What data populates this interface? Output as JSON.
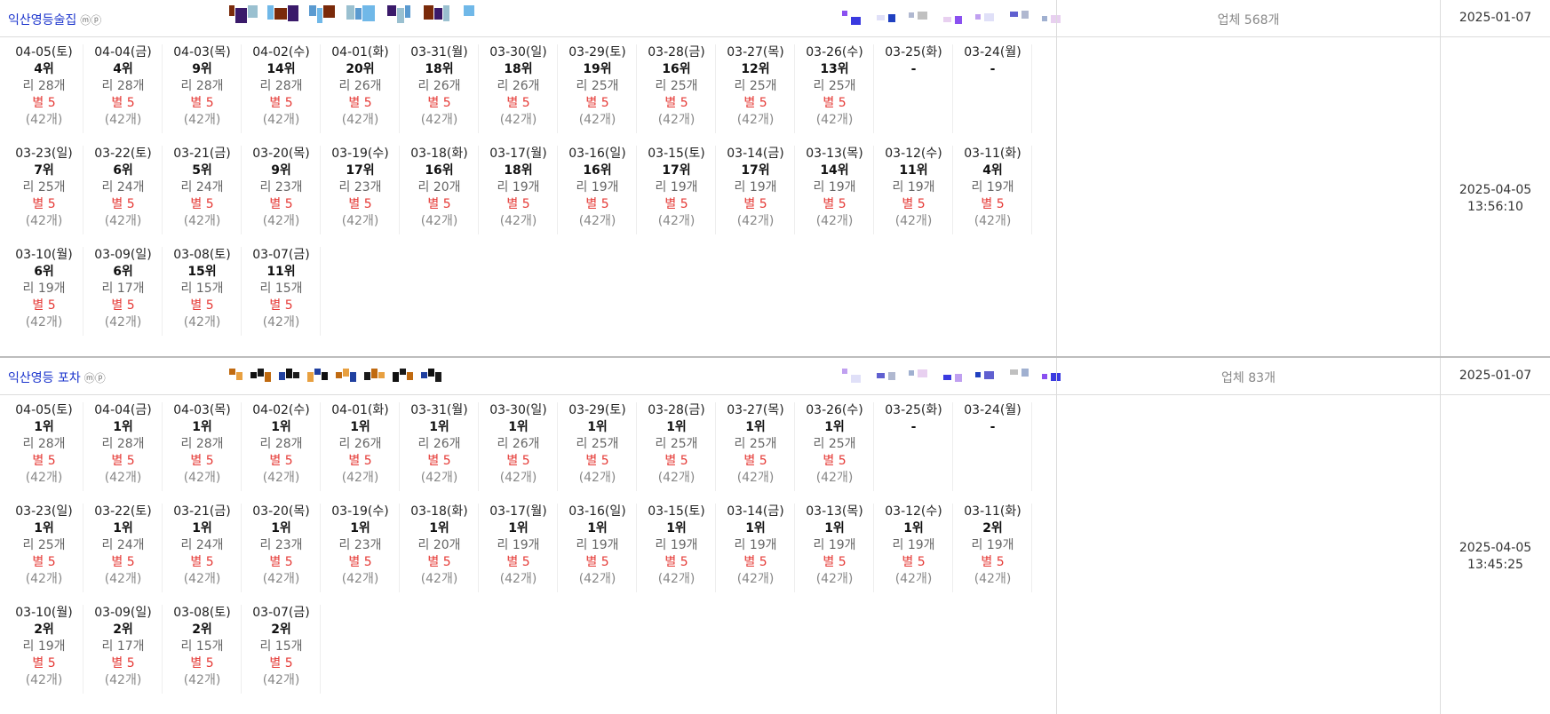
{
  "stores": [
    {
      "name": "익산영등술집",
      "badges": "ⓜⓟ",
      "count": "업체 568개",
      "start_date": "2025-01-07",
      "updated_date": "2025-04-05",
      "updated_time": "13:56:10",
      "rows": [
        [
          {
            "d": "04-05(토)",
            "r": "4위",
            "v": "리 28개",
            "s": "별 5",
            "c": "(42개)"
          },
          {
            "d": "04-04(금)",
            "r": "4위",
            "v": "리 28개",
            "s": "별 5",
            "c": "(42개)"
          },
          {
            "d": "04-03(목)",
            "r": "9위",
            "v": "리 28개",
            "s": "별 5",
            "c": "(42개)"
          },
          {
            "d": "04-02(수)",
            "r": "14위",
            "v": "리 28개",
            "s": "별 5",
            "c": "(42개)"
          },
          {
            "d": "04-01(화)",
            "r": "20위",
            "v": "리 26개",
            "s": "별 5",
            "c": "(42개)"
          },
          {
            "d": "03-31(월)",
            "r": "18위",
            "v": "리 26개",
            "s": "별 5",
            "c": "(42개)"
          },
          {
            "d": "03-30(일)",
            "r": "18위",
            "v": "리 26개",
            "s": "별 5",
            "c": "(42개)"
          },
          {
            "d": "03-29(토)",
            "r": "19위",
            "v": "리 25개",
            "s": "별 5",
            "c": "(42개)"
          },
          {
            "d": "03-28(금)",
            "r": "16위",
            "v": "리 25개",
            "s": "별 5",
            "c": "(42개)"
          },
          {
            "d": "03-27(목)",
            "r": "12위",
            "v": "리 25개",
            "s": "별 5",
            "c": "(42개)"
          },
          {
            "d": "03-26(수)",
            "r": "13위",
            "v": "리 25개",
            "s": "별 5",
            "c": "(42개)"
          },
          {
            "d": "03-25(화)",
            "r": "-",
            "v": "",
            "s": "",
            "c": ""
          },
          {
            "d": "03-24(월)",
            "r": "-",
            "v": "",
            "s": "",
            "c": ""
          }
        ],
        [
          {
            "d": "03-23(일)",
            "r": "7위",
            "v": "리 25개",
            "s": "별 5",
            "c": "(42개)"
          },
          {
            "d": "03-22(토)",
            "r": "6위",
            "v": "리 24개",
            "s": "별 5",
            "c": "(42개)"
          },
          {
            "d": "03-21(금)",
            "r": "5위",
            "v": "리 24개",
            "s": "별 5",
            "c": "(42개)"
          },
          {
            "d": "03-20(목)",
            "r": "9위",
            "v": "리 23개",
            "s": "별 5",
            "c": "(42개)"
          },
          {
            "d": "03-19(수)",
            "r": "17위",
            "v": "리 23개",
            "s": "별 5",
            "c": "(42개)"
          },
          {
            "d": "03-18(화)",
            "r": "16위",
            "v": "리 20개",
            "s": "별 5",
            "c": "(42개)"
          },
          {
            "d": "03-17(월)",
            "r": "18위",
            "v": "리 19개",
            "s": "별 5",
            "c": "(42개)"
          },
          {
            "d": "03-16(일)",
            "r": "16위",
            "v": "리 19개",
            "s": "별 5",
            "c": "(42개)"
          },
          {
            "d": "03-15(토)",
            "r": "17위",
            "v": "리 19개",
            "s": "별 5",
            "c": "(42개)"
          },
          {
            "d": "03-14(금)",
            "r": "17위",
            "v": "리 19개",
            "s": "별 5",
            "c": "(42개)"
          },
          {
            "d": "03-13(목)",
            "r": "14위",
            "v": "리 19개",
            "s": "별 5",
            "c": "(42개)"
          },
          {
            "d": "03-12(수)",
            "r": "11위",
            "v": "리 19개",
            "s": "별 5",
            "c": "(42개)"
          },
          {
            "d": "03-11(화)",
            "r": "4위",
            "v": "리 19개",
            "s": "별 5",
            "c": "(42개)"
          }
        ],
        [
          {
            "d": "03-10(월)",
            "r": "6위",
            "v": "리 19개",
            "s": "별 5",
            "c": "(42개)"
          },
          {
            "d": "03-09(일)",
            "r": "6위",
            "v": "리 17개",
            "s": "별 5",
            "c": "(42개)"
          },
          {
            "d": "03-08(토)",
            "r": "15위",
            "v": "리 15개",
            "s": "별 5",
            "c": "(42개)"
          },
          {
            "d": "03-07(금)",
            "r": "11위",
            "v": "리 15개",
            "s": "별 5",
            "c": "(42개)"
          }
        ]
      ]
    },
    {
      "name": "익산영등 포차",
      "badges": "ⓜⓟ",
      "count": "업체 83개",
      "start_date": "2025-01-07",
      "updated_date": "2025-04-05",
      "updated_time": "13:45:25",
      "rows": [
        [
          {
            "d": "04-05(토)",
            "r": "1위",
            "v": "리 28개",
            "s": "별 5",
            "c": "(42개)"
          },
          {
            "d": "04-04(금)",
            "r": "1위",
            "v": "리 28개",
            "s": "별 5",
            "c": "(42개)"
          },
          {
            "d": "04-03(목)",
            "r": "1위",
            "v": "리 28개",
            "s": "별 5",
            "c": "(42개)"
          },
          {
            "d": "04-02(수)",
            "r": "1위",
            "v": "리 28개",
            "s": "별 5",
            "c": "(42개)"
          },
          {
            "d": "04-01(화)",
            "r": "1위",
            "v": "리 26개",
            "s": "별 5",
            "c": "(42개)"
          },
          {
            "d": "03-31(월)",
            "r": "1위",
            "v": "리 26개",
            "s": "별 5",
            "c": "(42개)"
          },
          {
            "d": "03-30(일)",
            "r": "1위",
            "v": "리 26개",
            "s": "별 5",
            "c": "(42개)"
          },
          {
            "d": "03-29(토)",
            "r": "1위",
            "v": "리 25개",
            "s": "별 5",
            "c": "(42개)"
          },
          {
            "d": "03-28(금)",
            "r": "1위",
            "v": "리 25개",
            "s": "별 5",
            "c": "(42개)"
          },
          {
            "d": "03-27(목)",
            "r": "1위",
            "v": "리 25개",
            "s": "별 5",
            "c": "(42개)"
          },
          {
            "d": "03-26(수)",
            "r": "1위",
            "v": "리 25개",
            "s": "별 5",
            "c": "(42개)"
          },
          {
            "d": "03-25(화)",
            "r": "-",
            "v": "",
            "s": "",
            "c": ""
          },
          {
            "d": "03-24(월)",
            "r": "-",
            "v": "",
            "s": "",
            "c": ""
          }
        ],
        [
          {
            "d": "03-23(일)",
            "r": "1위",
            "v": "리 25개",
            "s": "별 5",
            "c": "(42개)"
          },
          {
            "d": "03-22(토)",
            "r": "1위",
            "v": "리 24개",
            "s": "별 5",
            "c": "(42개)"
          },
          {
            "d": "03-21(금)",
            "r": "1위",
            "v": "리 24개",
            "s": "별 5",
            "c": "(42개)"
          },
          {
            "d": "03-20(목)",
            "r": "1위",
            "v": "리 23개",
            "s": "별 5",
            "c": "(42개)"
          },
          {
            "d": "03-19(수)",
            "r": "1위",
            "v": "리 23개",
            "s": "별 5",
            "c": "(42개)"
          },
          {
            "d": "03-18(화)",
            "r": "1위",
            "v": "리 20개",
            "s": "별 5",
            "c": "(42개)"
          },
          {
            "d": "03-17(월)",
            "r": "1위",
            "v": "리 19개",
            "s": "별 5",
            "c": "(42개)"
          },
          {
            "d": "03-16(일)",
            "r": "1위",
            "v": "리 19개",
            "s": "별 5",
            "c": "(42개)"
          },
          {
            "d": "03-15(토)",
            "r": "1위",
            "v": "리 19개",
            "s": "별 5",
            "c": "(42개)"
          },
          {
            "d": "03-14(금)",
            "r": "1위",
            "v": "리 19개",
            "s": "별 5",
            "c": "(42개)"
          },
          {
            "d": "03-13(목)",
            "r": "1위",
            "v": "리 19개",
            "s": "별 5",
            "c": "(42개)"
          },
          {
            "d": "03-12(수)",
            "r": "1위",
            "v": "리 19개",
            "s": "별 5",
            "c": "(42개)"
          },
          {
            "d": "03-11(화)",
            "r": "2위",
            "v": "리 19개",
            "s": "별 5",
            "c": "(42개)"
          }
        ],
        [
          {
            "d": "03-10(월)",
            "r": "2위",
            "v": "리 19개",
            "s": "별 5",
            "c": "(42개)"
          },
          {
            "d": "03-09(일)",
            "r": "2위",
            "v": "리 17개",
            "s": "별 5",
            "c": "(42개)"
          },
          {
            "d": "03-08(토)",
            "r": "2위",
            "v": "리 15개",
            "s": "별 5",
            "c": "(42개)"
          },
          {
            "d": "03-07(금)",
            "r": "2위",
            "v": "리 15개",
            "s": "별 5",
            "c": "(42개)"
          }
        ]
      ]
    }
  ],
  "colors": {
    "name_link": "#1a33cc",
    "star_text": "#e53935",
    "muted_text": "#888888"
  }
}
